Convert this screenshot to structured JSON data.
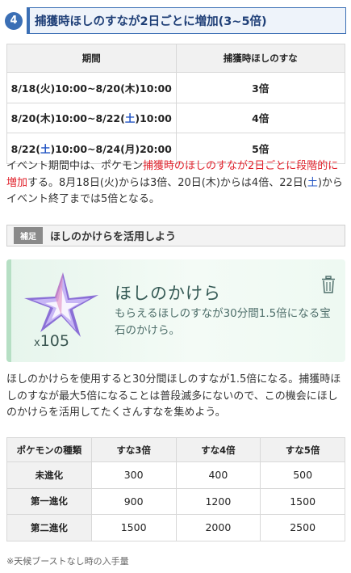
{
  "heading": {
    "number": "4",
    "title": "捕獲時ほしのすなが2日ごとに増加(3~5倍)"
  },
  "period_table": {
    "headers": [
      "期間",
      "捕獲時ほしのすな"
    ],
    "rows": [
      {
        "p1": "8/18(火)10:00~8/20(木)10:00",
        "value": "3倍"
      },
      {
        "p1": "8/20(木)10:00~8/22(",
        "p1_blue": "土",
        "p1_end": ")10:00",
        "value": "4倍"
      },
      {
        "p1": "8/22(",
        "p1_blue": "土",
        "p1_end": ")10:00~8/24(月)20:00",
        "value": "5倍"
      }
    ]
  },
  "paragraph1": {
    "a": "イベント期間中は、ポケモン",
    "red": "捕獲時のほしのすなが2日ごとに段階的に増加",
    "b": "する。8月18日(火)からは3倍、20日(木)からは4倍、22日(",
    "blue": "土",
    "c": ")からイベント終了までは5倍となる。"
  },
  "supplement": {
    "tag": "補足",
    "text": "ほしのかけらを活用しよう"
  },
  "item_card": {
    "title": "ほしのかけら",
    "description": "もらえるほしのすなが30分間1.5倍になる宝石のかけら。",
    "quantity_prefix": "x",
    "quantity": "105",
    "icon": "trash-icon"
  },
  "paragraph2": "ほしのかけらを使用すると30分間ほしのすなが1.5倍になる。捕獲時ほしのすなが最大5倍になることは普段滅多にないので、この機会にほしのかけらを活用してたくさんすなを集めよう。",
  "stardust_table": {
    "headers": [
      "ポケモンの種類",
      "すな3倍",
      "すな4倍",
      "すな5倍"
    ],
    "rows": [
      [
        "未進化",
        "300",
        "400",
        "500"
      ],
      [
        "第一進化",
        "900",
        "1200",
        "1500"
      ],
      [
        "第二進化",
        "1500",
        "2000",
        "2500"
      ]
    ]
  },
  "note": "※天候ブーストなし時の入手量",
  "colors": {
    "accent_blue": "#3b6fb5",
    "emphasis_red": "#e0202a",
    "saturday_blue": "#2255c4"
  }
}
